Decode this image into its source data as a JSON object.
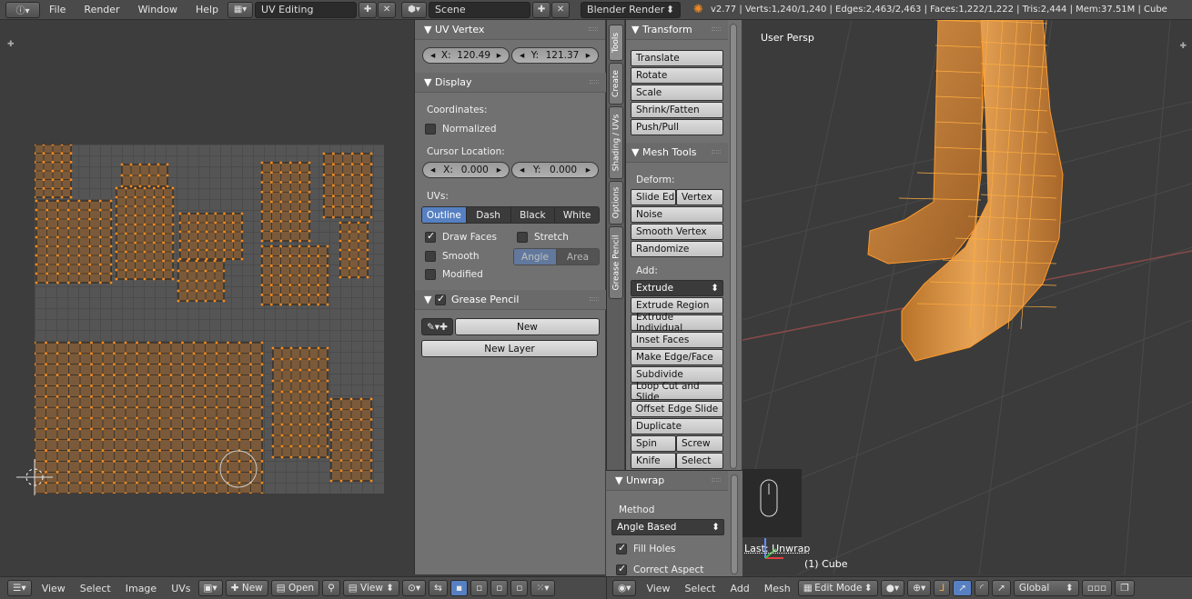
{
  "topbar": {
    "menus": [
      "File",
      "Render",
      "Window",
      "Help"
    ],
    "screen_layout": "UV Editing",
    "scene": "Scene",
    "render_engine": "Blender Render",
    "stats": "v2.77 | Verts:1,240/1,240 | Edges:2,463/2,463 | Faces:1,222/1,222 | Tris:2,444 | Mem:37.51M | Cube"
  },
  "uv_vertex": {
    "title": "UV Vertex",
    "x_label": "X:",
    "x_value": "120.49",
    "y_label": "Y:",
    "y_value": "121.37"
  },
  "display": {
    "title": "Display",
    "coordinates_label": "Coordinates:",
    "normalized": "Normalized",
    "cursor_label": "Cursor Location:",
    "cursor_x_label": "X:",
    "cursor_x": "0.000",
    "cursor_y_label": "Y:",
    "cursor_y": "0.000",
    "uvs_label": "UVs:",
    "uv_styles": [
      "Outline",
      "Dash",
      "Black",
      "White"
    ],
    "draw_faces": "Draw Faces",
    "stretch": "Stretch",
    "smooth": "Smooth",
    "stretch_modes": [
      "Angle",
      "Area"
    ],
    "modified": "Modified"
  },
  "grease_pencil": {
    "title": "Grease Pencil",
    "new_label": "New",
    "new_layer": "New Layer"
  },
  "tabs": [
    "Tools",
    "Create",
    "Shading / UVs",
    "Options",
    "Grease Pencil"
  ],
  "transform": {
    "title": "Transform",
    "buttons": [
      "Translate",
      "Rotate",
      "Scale",
      "Shrink/Fatten",
      "Push/Pull"
    ]
  },
  "mesh_tools": {
    "title": "Mesh Tools",
    "deform_label": "Deform:",
    "slide_edge": "Slide Ed",
    "vertex": "Vertex",
    "noise": "Noise",
    "smooth_vertex": "Smooth Vertex",
    "randomize": "Randomize",
    "add_label": "Add:",
    "extrude": "Extrude",
    "add_buttons": [
      "Extrude Region",
      "Extrude Individual",
      "Inset Faces",
      "Make Edge/Face",
      "Subdivide",
      "Loop Cut and Slide",
      "Offset Edge Slide",
      "Duplicate"
    ],
    "spin": "Spin",
    "screw": "Screw",
    "knife": "Knife",
    "select": "Select"
  },
  "unwrap": {
    "title": "Unwrap",
    "method_label": "Method",
    "method_value": "Angle Based",
    "fill_holes": "Fill Holes",
    "correct_aspect": "Correct Aspect"
  },
  "viewport": {
    "view_name": "User Persp",
    "last_op": "Last: Unwrap",
    "object": "(1) Cube"
  },
  "uv_bottom": {
    "menus": [
      "View",
      "Select",
      "Image",
      "UVs"
    ],
    "new": "New",
    "open": "Open",
    "view": "View"
  },
  "view3d_bottom": {
    "menus": [
      "View",
      "Select",
      "Add",
      "Mesh"
    ],
    "mode": "Edit Mode",
    "orientation": "Global"
  },
  "colors": {
    "accent": "#5680c2",
    "uv_orange": "#ff8c1a",
    "mesh_orange": "#e89a3c"
  }
}
